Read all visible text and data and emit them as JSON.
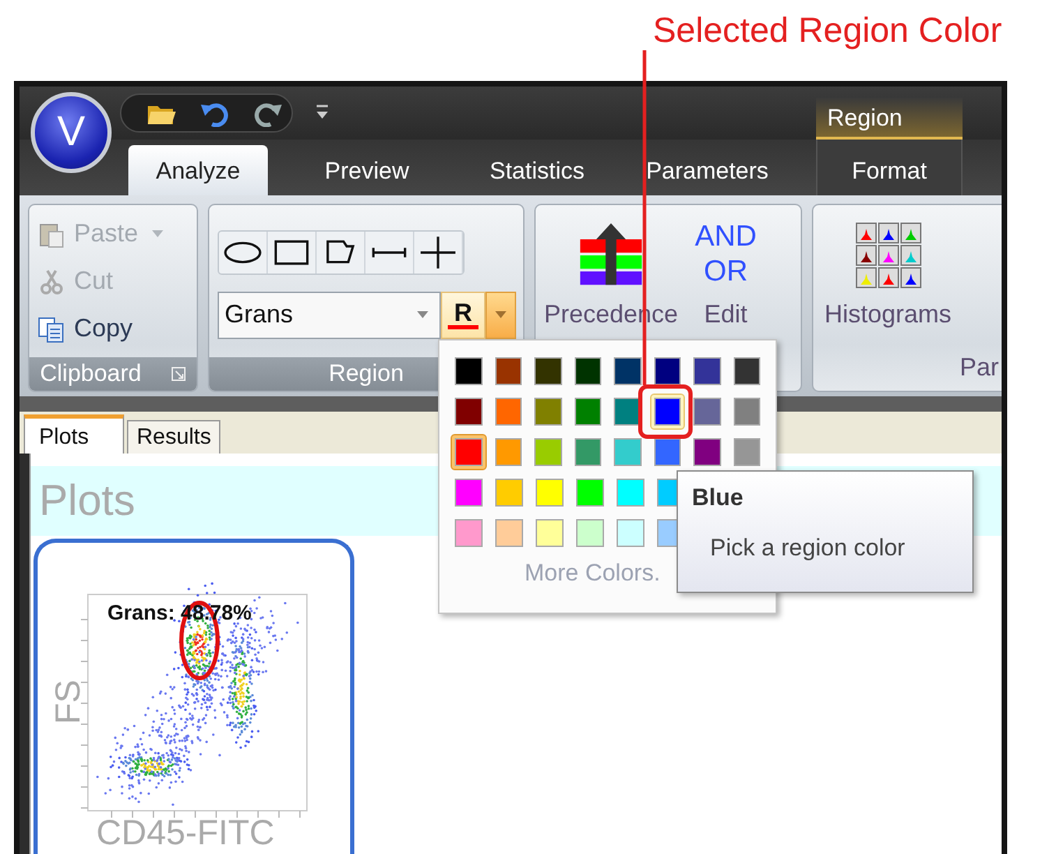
{
  "annotation": {
    "text": "Selected Region Color"
  },
  "app_logo": "V",
  "contextual_group": {
    "label": "Region"
  },
  "tabs": [
    {
      "label": "Analyze",
      "selected": true,
      "kind": "standard"
    },
    {
      "label": "Preview",
      "selected": false,
      "kind": "standard"
    },
    {
      "label": "Statistics",
      "selected": false,
      "kind": "standard"
    },
    {
      "label": "Parameters",
      "selected": false,
      "kind": "standard"
    },
    {
      "label": "Format",
      "selected": false,
      "kind": "contextual"
    }
  ],
  "ribbon": {
    "clipboard": {
      "label": "Clipboard",
      "items": [
        {
          "label": "Paste",
          "disabled": true
        },
        {
          "label": "Cut",
          "disabled": true
        },
        {
          "label": "Copy",
          "disabled": false
        }
      ]
    },
    "region": {
      "label": "Region",
      "region_name": "Grans",
      "color_button": {
        "letter": "R",
        "color": "#ff0000"
      }
    },
    "gates": {
      "precedence": "Precedence",
      "and": "AND",
      "or": "OR",
      "edit": "Edit"
    },
    "histograms": {
      "label": "Histograms",
      "cut_label": "Par"
    }
  },
  "color_palette": {
    "rows": [
      [
        {
          "color": "#000000",
          "selected": false,
          "hovered": false
        },
        {
          "color": "#993300",
          "selected": false,
          "hovered": false
        },
        {
          "color": "#333300",
          "selected": false,
          "hovered": false
        },
        {
          "color": "#003300",
          "selected": false,
          "hovered": false
        },
        {
          "color": "#003366",
          "selected": false,
          "hovered": false
        },
        {
          "color": "#000080",
          "selected": false,
          "hovered": false
        },
        {
          "color": "#333399",
          "selected": false,
          "hovered": false
        },
        {
          "color": "#333333",
          "selected": false,
          "hovered": false
        }
      ],
      [
        {
          "color": "#800000",
          "selected": false,
          "hovered": false
        },
        {
          "color": "#ff6600",
          "selected": false,
          "hovered": false
        },
        {
          "color": "#808000",
          "selected": false,
          "hovered": false
        },
        {
          "color": "#008000",
          "selected": false,
          "hovered": false
        },
        {
          "color": "#008080",
          "selected": false,
          "hovered": false
        },
        {
          "color": "#0000ff",
          "selected": false,
          "hovered": true
        },
        {
          "color": "#666699",
          "selected": false,
          "hovered": false
        },
        {
          "color": "#808080",
          "selected": false,
          "hovered": false
        }
      ],
      [
        {
          "color": "#ff0000",
          "selected": true,
          "hovered": false
        },
        {
          "color": "#ff9900",
          "selected": false,
          "hovered": false
        },
        {
          "color": "#99cc00",
          "selected": false,
          "hovered": false
        },
        {
          "color": "#339966",
          "selected": false,
          "hovered": false
        },
        {
          "color": "#33cccc",
          "selected": false,
          "hovered": false
        },
        {
          "color": "#3366ff",
          "selected": false,
          "hovered": false
        },
        {
          "color": "#800080",
          "selected": false,
          "hovered": false
        },
        {
          "color": "#969696",
          "selected": false,
          "hovered": false
        }
      ],
      [
        {
          "color": "#ff00ff",
          "selected": false,
          "hovered": false
        },
        {
          "color": "#ffcc00",
          "selected": false,
          "hovered": false
        },
        {
          "color": "#ffff00",
          "selected": false,
          "hovered": false
        },
        {
          "color": "#00ff00",
          "selected": false,
          "hovered": false
        },
        {
          "color": "#00ffff",
          "selected": false,
          "hovered": false
        },
        {
          "color": "#00ccff",
          "selected": false,
          "hovered": false
        }
      ],
      [
        {
          "color": "#ff99cc",
          "selected": false,
          "hovered": false
        },
        {
          "color": "#ffcc99",
          "selected": false,
          "hovered": false
        },
        {
          "color": "#ffff99",
          "selected": false,
          "hovered": false
        },
        {
          "color": "#ccffcc",
          "selected": false,
          "hovered": false
        },
        {
          "color": "#ccffff",
          "selected": false,
          "hovered": false
        },
        {
          "color": "#99ccff",
          "selected": false,
          "hovered": false
        }
      ]
    ],
    "more": "More Colors."
  },
  "tooltip": {
    "title": "Blue",
    "text": "Pick a region color"
  },
  "document_tabs": [
    {
      "label": "Plots",
      "selected": true
    },
    {
      "label": "Results",
      "selected": false
    }
  ],
  "plots": {
    "title": "Plots",
    "plot": {
      "region_label": "Grans: 48.78%",
      "y_axis": "FS",
      "x_axis": "CD45-FITC"
    }
  }
}
